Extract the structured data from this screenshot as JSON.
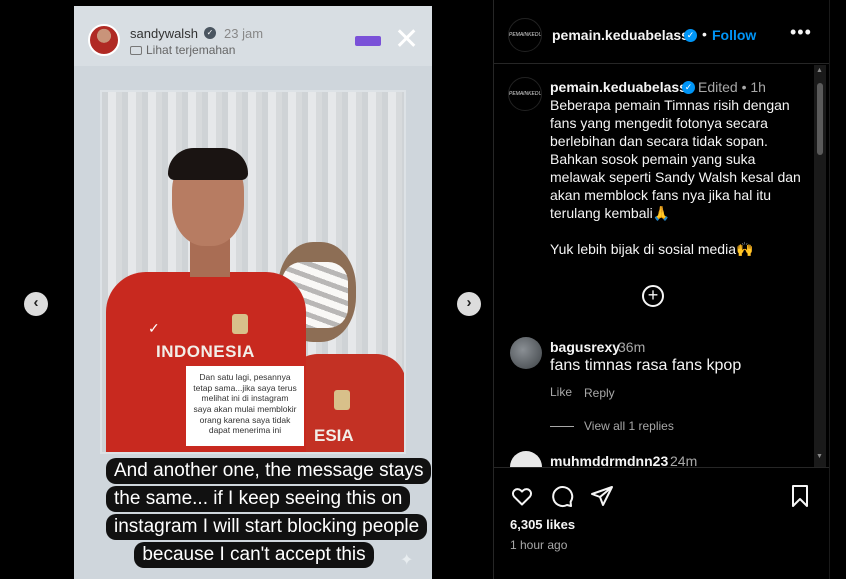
{
  "story": {
    "username": "sandywalsh",
    "time": "23 jam",
    "translate": "Lihat terjemahan",
    "note_text": "Dan satu lagi, pesannya tetap sama...jika saya terus melihat ini di instagram saya akan mulai memblokir orang karena saya tidak dapat menerima ini",
    "jersey_text": "INDONESIA",
    "jersey_text_2": "ESIA",
    "caption_lines": [
      "And another one, the message stays",
      "the same... if I keep seeing this on",
      "instagram I will start blocking people",
      "because I can't accept this"
    ]
  },
  "nav": {
    "prev": "‹",
    "next": "›"
  },
  "header": {
    "username": "pemain.keduabelass",
    "follow": "Follow",
    "dot": "•",
    "more": "•••",
    "logo_text": "PEMAINKEDUABELAS"
  },
  "caption": {
    "username": "pemain.keduabelass",
    "edited": "Edited • 1h",
    "paragraph1": "Beberapa pemain Timnas risih dengan fans yang mengedit fotonya secara berlebihan dan secara tidak sopan. Bahkan sosok pemain yang suka melawak seperti Sandy Walsh kesal dan akan memblock fans nya jika hal itu terulang kembali🙏",
    "paragraph2": "Yuk lebih bijak di sosial media🙌"
  },
  "comments": [
    {
      "username": "bagusrexy",
      "time": "36m",
      "text": "fans timnas rasa fans kpop",
      "like": "Like",
      "reply": "Reply",
      "view_replies": "View all 1 replies"
    },
    {
      "username": "muhmddrmdnn23",
      "time": "24m"
    }
  ],
  "actions": {
    "likes": "6,305 likes",
    "time": "1 hour ago"
  },
  "icons": [
    "heart-icon",
    "comment-icon",
    "share-icon",
    "bookmark-icon",
    "add-circle-icon",
    "close-icon",
    "verified-icon",
    "more-icon"
  ],
  "colors": {
    "accent": "#0095f6",
    "jersey": "#c8291f",
    "background": "#000000"
  }
}
